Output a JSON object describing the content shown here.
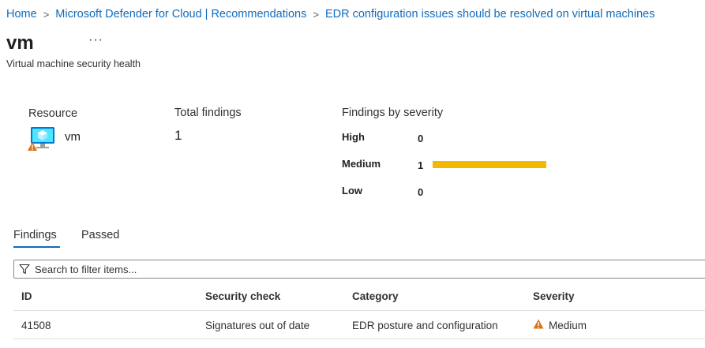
{
  "breadcrumb": {
    "items": [
      "Home",
      "Microsoft Defender for Cloud | Recommendations",
      "EDR configuration issues should be resolved on virtual machines"
    ],
    "separator": ">"
  },
  "header": {
    "title": "vm",
    "more": "···",
    "subtitle": "Virtual machine security health"
  },
  "summary": {
    "resource_label": "Resource",
    "resource_name": "vm",
    "total_label": "Total findings",
    "total_value": "1",
    "severity_label": "Findings by severity",
    "severities": [
      {
        "label": "High",
        "count": "0",
        "fraction": 0
      },
      {
        "label": "Medium",
        "count": "1",
        "fraction": 1
      },
      {
        "label": "Low",
        "count": "0",
        "fraction": 0
      }
    ]
  },
  "tabs": [
    "Findings",
    "Passed"
  ],
  "search": {
    "placeholder": "Search to filter items..."
  },
  "table": {
    "columns": [
      "ID",
      "Security check",
      "Category",
      "Severity"
    ],
    "rows": [
      {
        "id": "41508",
        "check": "Signatures out of date",
        "category": "EDR posture and configuration",
        "severity": "Medium"
      }
    ]
  },
  "colors": {
    "link": "#0f6cbd",
    "medium_bar": "#f2b900",
    "warning": "#d9731a",
    "vm_icon": "#0078d4"
  }
}
